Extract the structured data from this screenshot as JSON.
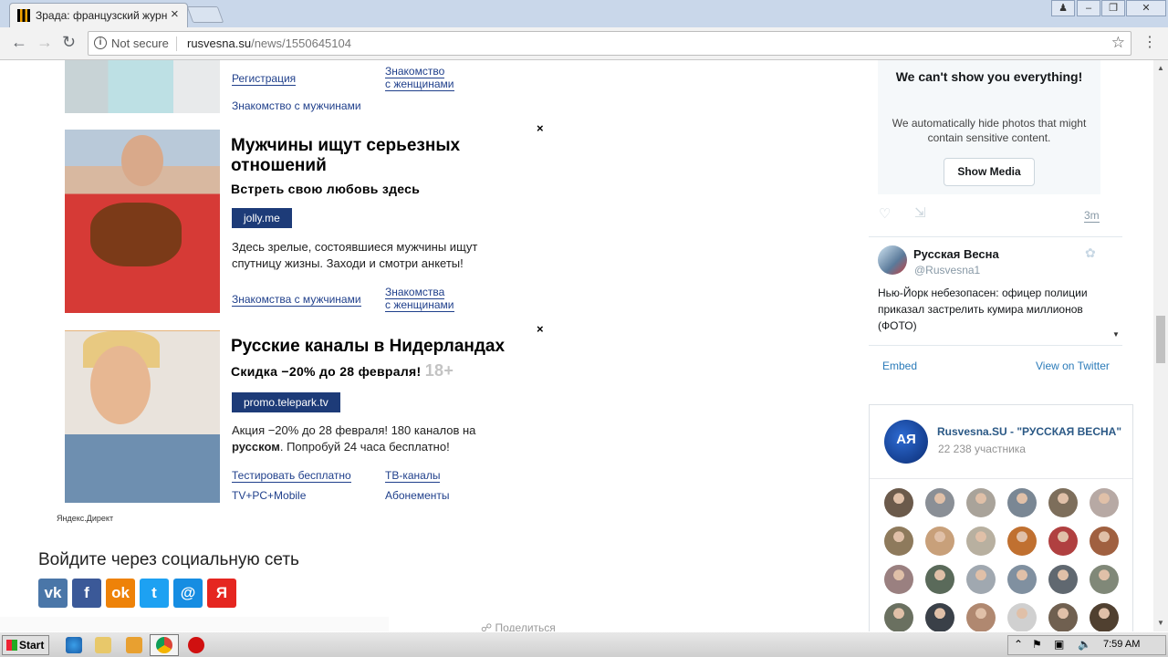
{
  "browser": {
    "tab_title": "Зрада: французский журн",
    "not_secure": "Not secure",
    "url_host": "rusvesna.su",
    "url_path": "/news/1550645104"
  },
  "ad_top": {
    "link_left": "Регистрация",
    "link_right": "Знакомство с женщинами",
    "link_right_line1": "Знакомство",
    "link_right_line2": "с женщинами",
    "link_bottom": "Знакомство с мужчинами"
  },
  "ad1": {
    "title_line1": "Мужчины ищут серьезных",
    "title_line2": "отношений",
    "subtitle": "Встреть свою любовь здесь",
    "domain": "jolly.me",
    "text": "Здесь зрелые, состоявшиеся мужчины ищут спутницу жизны. Заходи и смотри анкеты!",
    "link_left": "Знакомства с мужчинами",
    "link_right_line1": "Знакомства",
    "link_right_line2": "с женщинами",
    "close": "×"
  },
  "ad2": {
    "title": "Русские каналы в Нидерландах",
    "subtitle": "Скидка −20% до 28 февраля!",
    "age": "18+",
    "domain": "promo.telepark.tv",
    "text_part1": "Акция −20% до 28 февраля! 180 каналов на ",
    "text_bold": "русском",
    "text_part2": ". Попробуй 24 часа бесплатно!",
    "link1": "Тестировать бесплатно",
    "link2": "ТВ-каналы",
    "link3": "TV+PC+Mobile",
    "link4": "Абонементы",
    "close": "×"
  },
  "yandex_direct": "Яндекс.Директ",
  "social": {
    "title": "Войдите через социальную сеть",
    "buttons": [
      {
        "name": "vk",
        "glyph": "vk",
        "color": "#4a76a8"
      },
      {
        "name": "facebook",
        "glyph": "f",
        "color": "#3b5998"
      },
      {
        "name": "odnoklassniki",
        "glyph": "ok",
        "color": "#ee8208"
      },
      {
        "name": "twitter",
        "glyph": "t",
        "color": "#1da1f2"
      },
      {
        "name": "moimir",
        "glyph": "@",
        "color": "#168de2"
      },
      {
        "name": "yandex",
        "glyph": "Я",
        "color": "#e52620"
      }
    ]
  },
  "share_label": "Поделиться",
  "twitter": {
    "media_title": "We can't show you everything!",
    "media_text": "We automatically hide photos that might contain sensitive content.",
    "media_button": "Show Media",
    "time": "3m",
    "author_name": "Русская Весна",
    "author_handle": "@Rusvesna1",
    "tweet_text": "Нью-Йорк небезопасен: офицер полиции приказал застрелить кумира миллионов (ФОТО)",
    "embed": "Embed",
    "view_on_twitter": "View on Twitter"
  },
  "vk_widget": {
    "title": "Rusvesna.SU - \"РУССКАЯ ВЕСНА\"",
    "members": "22 238 участника",
    "avatar_colors": [
      "#6b5a4b",
      "#8a8f96",
      "#a9a39a",
      "#7a8794",
      "#7d6e5b",
      "#b7a9a4",
      "#8e7a5c",
      "#c8a07a",
      "#b8b0a0",
      "#c07030",
      "#b04040",
      "#a06040",
      "#9a8080",
      "#5a6a5a",
      "#a0a8b0",
      "#8090a0",
      "#606870",
      "#808878",
      "#6a7060",
      "#3a4048",
      "#b08870",
      "#d0d0d0",
      "#706050",
      "#504030"
    ]
  },
  "taskbar": {
    "start": "Start",
    "clock": "7:59 AM"
  }
}
